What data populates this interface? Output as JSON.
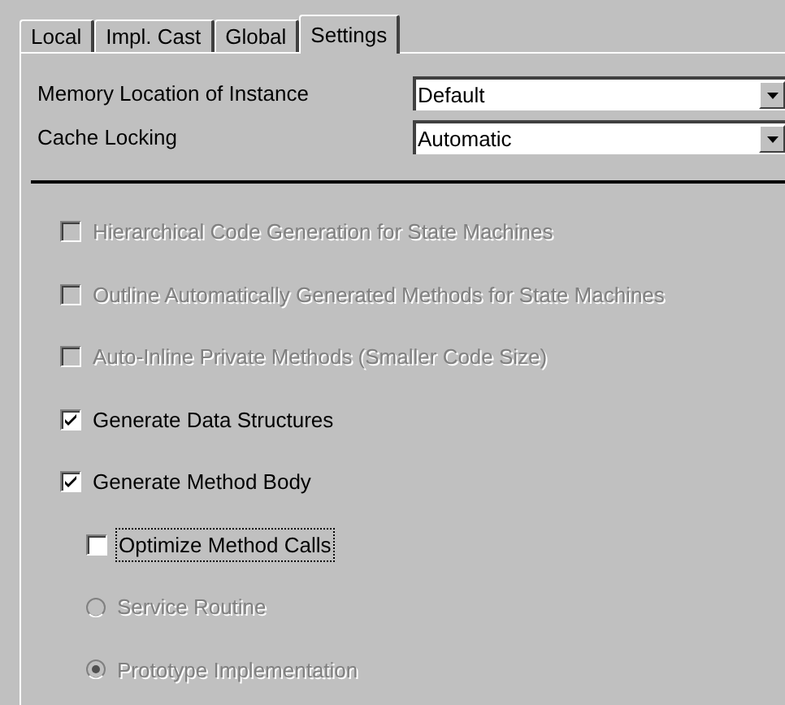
{
  "tabs": [
    {
      "label": "Local",
      "selected": false
    },
    {
      "label": "Impl. Cast",
      "selected": false
    },
    {
      "label": "Global",
      "selected": false
    },
    {
      "label": "Settings",
      "selected": true
    }
  ],
  "fields": [
    {
      "label": "Memory Location of Instance",
      "value": "Default"
    },
    {
      "label": "Cache Locking",
      "value": "Automatic"
    }
  ],
  "options": [
    {
      "kind": "checkbox",
      "label": "Hierarchical Code Generation for State Machines",
      "checked": false,
      "disabled": true,
      "focused": false
    },
    {
      "kind": "checkbox",
      "label": "Outline Automatically Generated Methods for State Machines",
      "checked": false,
      "disabled": true,
      "focused": false
    },
    {
      "kind": "checkbox",
      "label": "Auto-Inline Private Methods (Smaller Code Size)",
      "checked": false,
      "disabled": true,
      "focused": false
    },
    {
      "kind": "checkbox",
      "label": "Generate Data Structures",
      "checked": true,
      "disabled": false,
      "focused": false
    },
    {
      "kind": "checkbox",
      "label": "Generate Method Body",
      "checked": true,
      "disabled": false,
      "focused": false,
      "children": [
        {
          "kind": "checkbox",
          "label": "Optimize Method Calls",
          "checked": false,
          "disabled": false,
          "focused": true
        },
        {
          "kind": "radio",
          "label": "Service Routine",
          "selected": false,
          "disabled": true,
          "focused": false
        },
        {
          "kind": "radio",
          "label": "Prototype Implementation",
          "selected": true,
          "disabled": true,
          "focused": false
        }
      ]
    }
  ]
}
